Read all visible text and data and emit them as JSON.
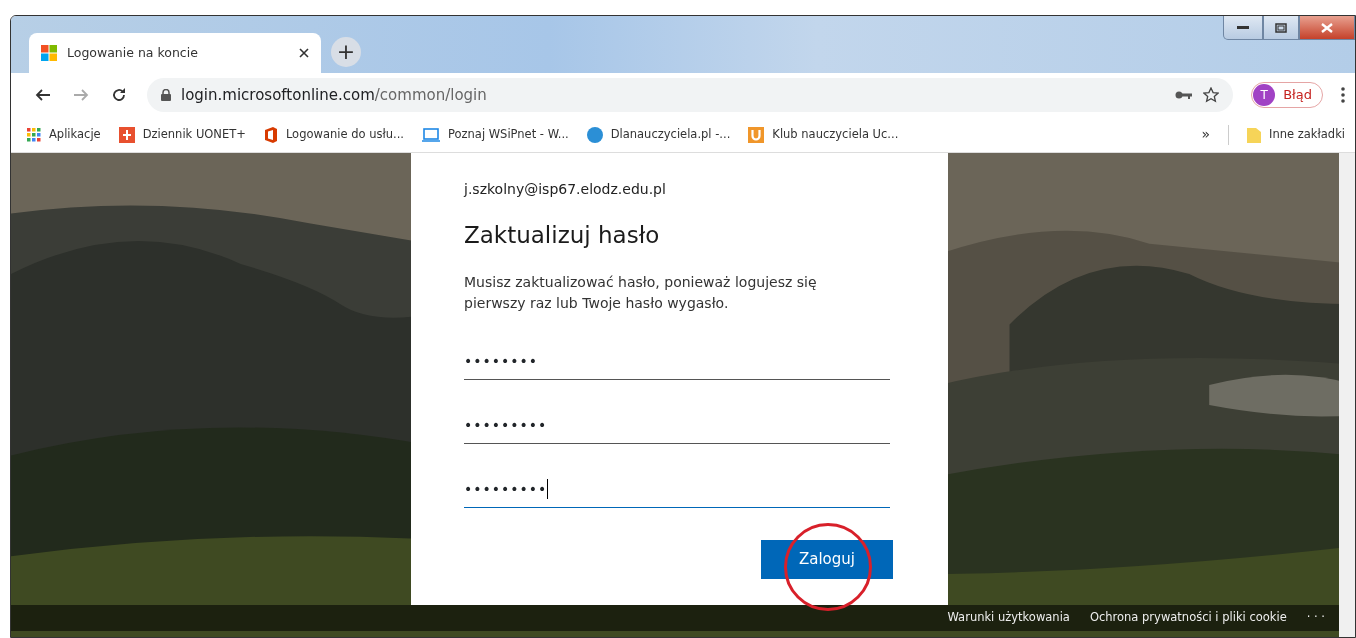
{
  "tab": {
    "title": "Logowanie na koncie",
    "selected": true
  },
  "new_tab": {
    "label": "+"
  },
  "address": {
    "host": "login.microsoftonline.com",
    "path": "/common/login"
  },
  "profile": {
    "initial": "T",
    "label": "Błąd"
  },
  "bookmarks": [
    {
      "label": "Aplikacje",
      "kind": "apps"
    },
    {
      "label": "Dziennik UONET+",
      "kind": "uonet"
    },
    {
      "label": "Logowanie do usłu...",
      "kind": "office"
    },
    {
      "label": "Poznaj WSiPnet - W...",
      "kind": "screen"
    },
    {
      "label": "Dlanauczyciela.pl -...",
      "kind": "globe"
    },
    {
      "label": "Klub nauczyciela Uc...",
      "kind": "u"
    }
  ],
  "other_bookmarks": {
    "overflow": "»",
    "label": "Inne zakładki"
  },
  "card": {
    "account": "j.szkolny@isp67.elodz.edu.pl",
    "title": "Zaktualizuj hasło",
    "message": "Musisz zaktualizować hasło, ponieważ logujesz się pierwszy raz lub Twoje hasło wygasło.",
    "fields": [
      {
        "value": "••••••••",
        "focused": false
      },
      {
        "value": "•••••••••",
        "focused": false
      },
      {
        "value": "•••••••••",
        "focused": true
      }
    ],
    "submit": "Zaloguj"
  },
  "footer": {
    "links": [
      "Warunki użytkowania",
      "Ochrona prywatności i pliki cookie"
    ],
    "more": "· · ·"
  }
}
